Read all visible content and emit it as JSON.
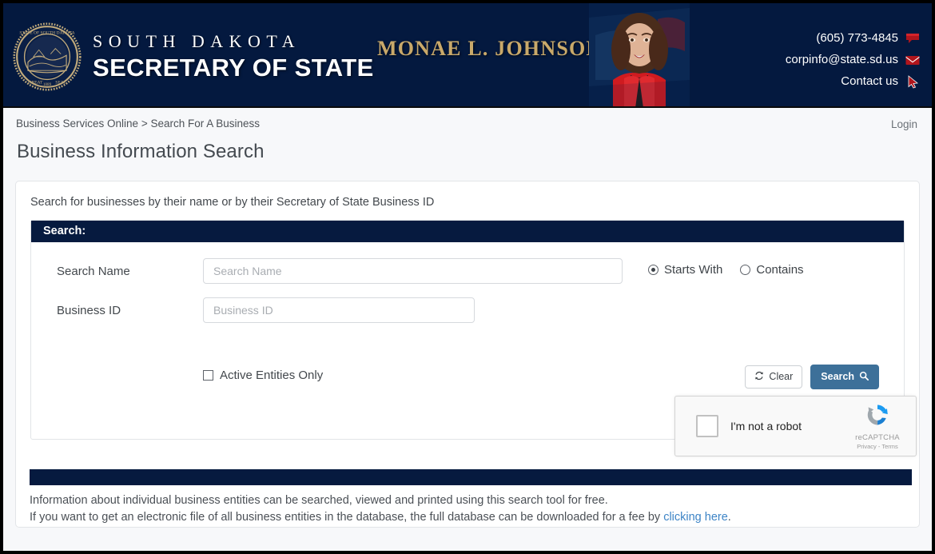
{
  "header": {
    "seal_icon": "state-seal-icon",
    "brand_line1": "SOUTH DAKOTA",
    "brand_line2": "SECRETARY OF STATE",
    "official_name": "MONAE L. JOHNSON",
    "portrait_alt": "Monae L. Johnson portrait",
    "contact": {
      "phone": "(605) 773-4845",
      "phone_icon": "phone-flag-icon",
      "email": "corpinfo@state.sd.us",
      "email_icon": "envelope-icon",
      "contact_link": "Contact us",
      "contact_icon": "cursor-arrow-icon"
    },
    "colors": {
      "navy": "#061a3f",
      "gold": "#c9a96a",
      "accent_red": "#a31d23"
    }
  },
  "breadcrumb": {
    "root": "Business Services Online",
    "separator": ">",
    "current": "Search For A Business",
    "full": "Business Services Online > Search For A Business"
  },
  "login_label": "Login",
  "page_title": "Business Information Search",
  "card": {
    "lead": "Search for businesses by their name or by their Secretary of State Business ID",
    "panel_title": "Search:",
    "fields": {
      "search_name": {
        "label": "Search Name",
        "placeholder": "Search Name",
        "value": ""
      },
      "business_id": {
        "label": "Business ID",
        "placeholder": "Business ID",
        "value": ""
      }
    },
    "match_mode": {
      "options": [
        {
          "label": "Starts With",
          "selected": true
        },
        {
          "label": "Contains",
          "selected": false
        }
      ]
    },
    "active_only": {
      "label": "Active Entities Only",
      "checked": false
    },
    "buttons": {
      "clear": "Clear",
      "clear_icon": "refresh-icon",
      "search": "Search",
      "search_icon": "magnifier-icon",
      "search_color": "#3d7099"
    },
    "recaptcha": {
      "label": "I'm not a robot",
      "brand": "reCAPTCHA",
      "legal": "Privacy - Terms",
      "checkbox_icon": "recaptcha-checkbox-icon",
      "logo_icon": "recaptcha-logo-icon",
      "checked": false
    }
  },
  "footer": {
    "line1": "Information about individual business entities can be searched, viewed and printed using this search tool for free.",
    "line2_before": "If you want to get an electronic file of all business entities in the database, the full database can be downloaded for a fee by ",
    "line2_link": "clicking here",
    "line2_after": "."
  }
}
